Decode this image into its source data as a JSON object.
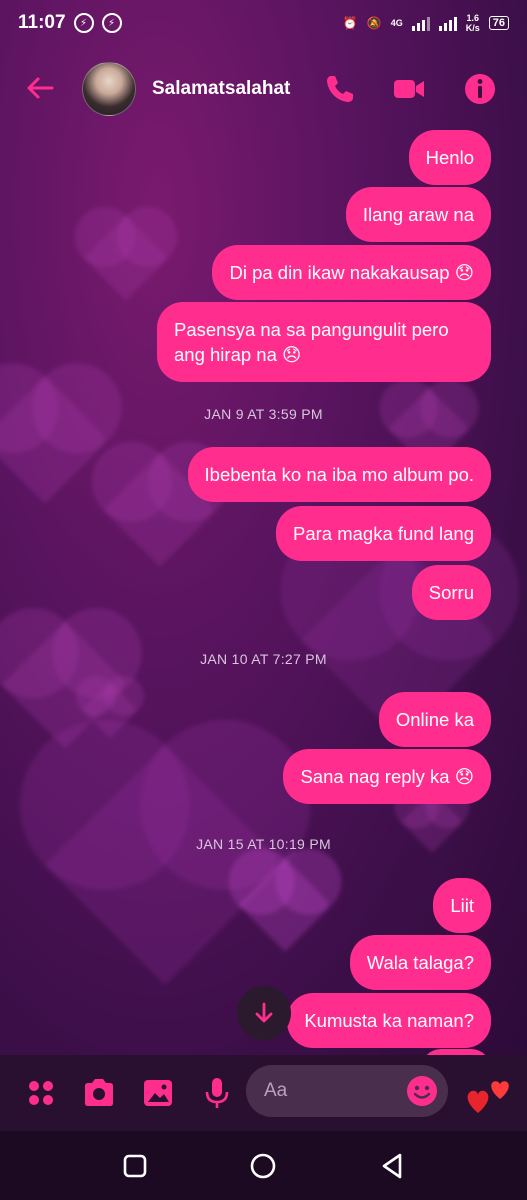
{
  "status_bar": {
    "time": "11:07",
    "network": "4G",
    "speed": "1.6",
    "speed_unit": "K/s",
    "battery": "76"
  },
  "header": {
    "contact_name": "Salamatsalahat",
    "icons": [
      "back-arrow-icon",
      "phone-icon",
      "video-camera-icon",
      "info-icon"
    ]
  },
  "messages": [
    {
      "text": "Henlo"
    },
    {
      "text": "Ilang araw na"
    },
    {
      "text": "Di pa din ikaw nakakausap 😞"
    },
    {
      "text": "Pasensya na sa pangungulit pero ang hirap na 😞"
    },
    {
      "text": "Ibebenta ko na iba mo album po."
    },
    {
      "text": "Para magka fund lang"
    },
    {
      "text": "Sorru"
    },
    {
      "text": "Online ka"
    },
    {
      "text": "Sana nag reply ka 😞"
    },
    {
      "text": "Liit"
    },
    {
      "text": "Wala talaga?"
    },
    {
      "text": "Kumusta ka naman?"
    }
  ],
  "timestamps": [
    "JAN 9 AT 3:59 PM",
    "JAN 10 AT 7:27 PM",
    "JAN 15 AT 10:19 PM"
  ],
  "composer": {
    "placeholder": "Aa",
    "icons": [
      "more-dots-icon",
      "camera-icon",
      "gallery-icon",
      "microphone-icon",
      "emoji-icon",
      "hearts-icon"
    ]
  },
  "colors": {
    "accent": "#ff2e8e",
    "bubble": "#ff2e8e",
    "background": "#4a1250"
  }
}
